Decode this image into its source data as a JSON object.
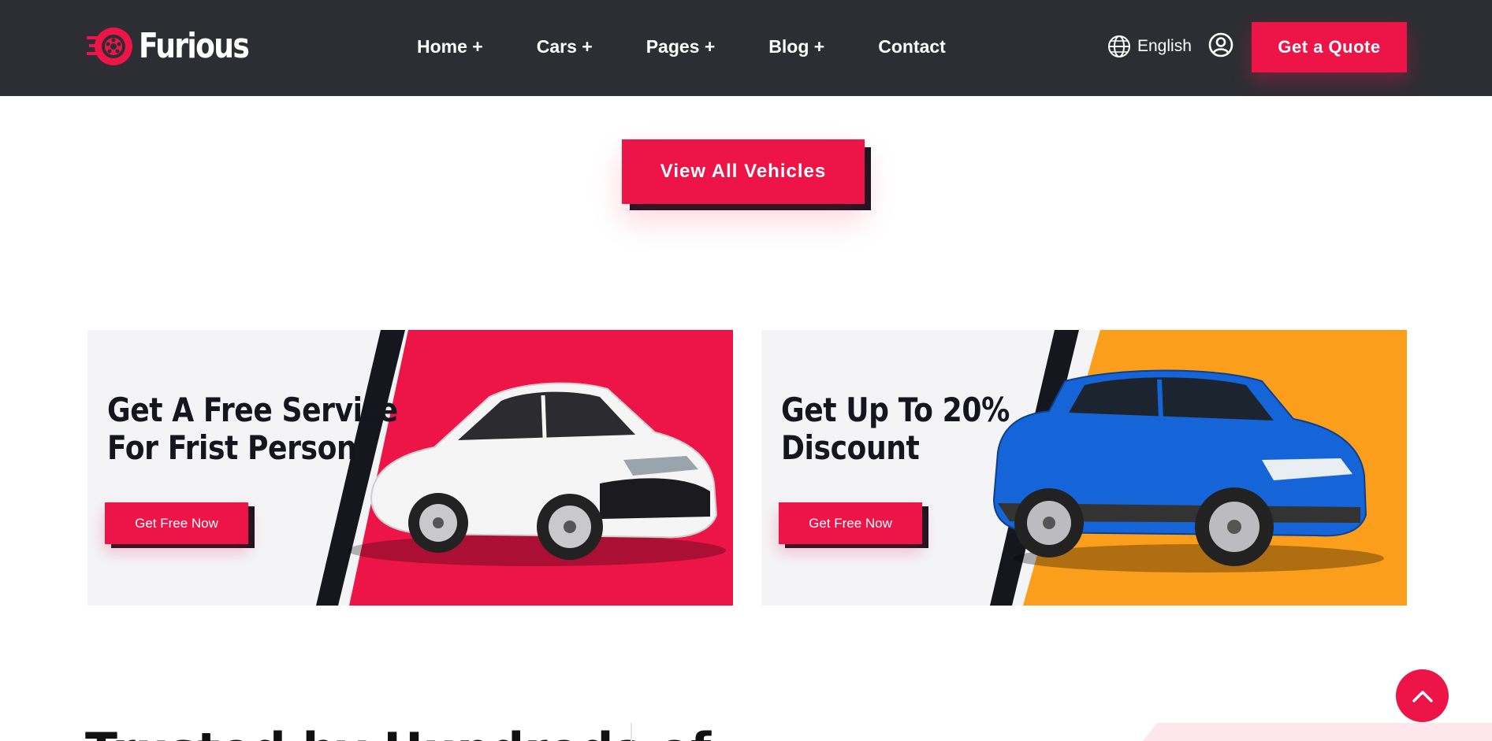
{
  "header": {
    "brand": "Furious",
    "nav": [
      {
        "label": "Home +"
      },
      {
        "label": "Cars +"
      },
      {
        "label": "Pages +"
      },
      {
        "label": "Blog +"
      },
      {
        "label": "Contact"
      }
    ],
    "language": "English",
    "cta": "Get a Quote"
  },
  "main": {
    "view_all": "View All Vehicles",
    "promos": [
      {
        "title_line1": "Get A Free Service",
        "title_line2": "For Frist Person",
        "button": "Get Free Now",
        "accent": "#ed1548"
      },
      {
        "title_line1": "Get Up To 20%",
        "title_line2": "Discount",
        "button": "Get Free Now",
        "accent": "#fb9e1b"
      }
    ],
    "next_heading": "Trusted by Hundreds of"
  },
  "colors": {
    "primary": "#ed1548",
    "header_bg": "#2d2e33",
    "dark": "#16161f",
    "orange": "#fb9e1b"
  },
  "icons": {
    "language": "globe-icon",
    "account": "user-circle-icon",
    "scroll": "chevron-up-icon"
  }
}
